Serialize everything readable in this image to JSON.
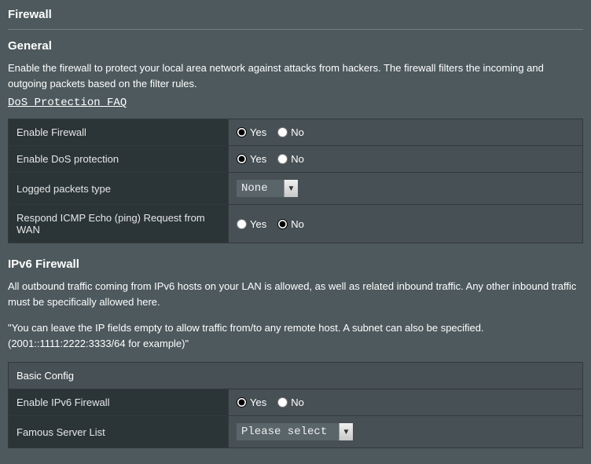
{
  "page_title": "Firewall",
  "general": {
    "heading": "General",
    "description": "Enable the firewall to protect your local area network against attacks from hackers. The firewall filters the incoming and outgoing packets based on the filter rules.",
    "faq_link": "DoS Protection FAQ",
    "rows": {
      "enable_firewall": {
        "label": "Enable Firewall",
        "yes": "Yes",
        "no": "No",
        "value": "yes"
      },
      "enable_dos": {
        "label": "Enable DoS protection",
        "yes": "Yes",
        "no": "No",
        "value": "yes"
      },
      "logged_packets": {
        "label": "Logged packets type",
        "selected": "None"
      },
      "respond_icmp": {
        "label": "Respond ICMP Echo (ping) Request from WAN",
        "yes": "Yes",
        "no": "No",
        "value": "no"
      }
    }
  },
  "ipv6": {
    "heading": "IPv6 Firewall",
    "desc1": "All outbound traffic coming from IPv6 hosts on your LAN is allowed, as well as related inbound traffic. Any other inbound traffic must be specifically allowed here.",
    "desc2": "\"You can leave the IP fields empty to allow traffic from/to any remote host. A subnet can also be specified. (2001::1111:2222:3333/64 for example)\"",
    "band_header": "Basic Config",
    "rows": {
      "enable_ipv6": {
        "label": "Enable IPv6 Firewall",
        "yes": "Yes",
        "no": "No",
        "value": "yes"
      },
      "famous_server": {
        "label": "Famous Server List",
        "selected": "Please select"
      }
    }
  }
}
